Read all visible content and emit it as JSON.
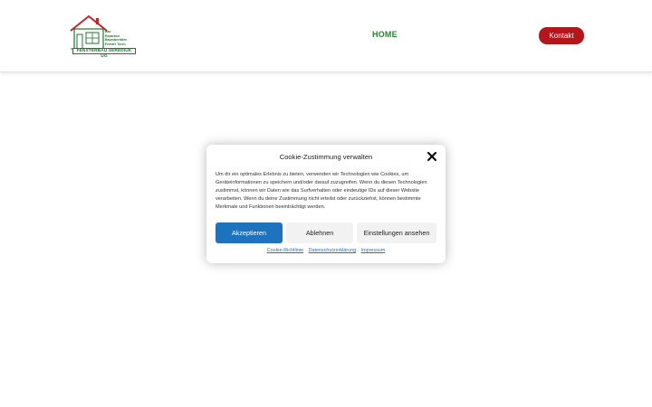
{
  "header": {
    "logo": {
      "tagline_lines": [
        "Bau",
        "Reparatur",
        "Baumaterialien",
        "Fenster Türen"
      ],
      "company_name": "FENSTERBAU SEREDIUK UG"
    },
    "nav": {
      "home_label": "HOME"
    },
    "contact_label": "Kontakt"
  },
  "cookie_dialog": {
    "title": "Cookie-Zustimmung verwalten",
    "close_icon": "close-icon",
    "body": "Um dir ein optimales Erlebnis zu bieten, verwenden wir Technologien wie Cookies, um Geräteinformationen zu speichern und/oder darauf zuzugreifen. Wenn du diesen Technologien zustimmst, können wir Daten wie das Surfverhalten oder eindeutige IDs auf dieser Website verarbeiten. Wenn du deine Zustimmung nicht erteilst oder zurückziehst, können bestimmte Merkmale und Funktionen beeinträchtigt werden.",
    "buttons": {
      "accept": "Akzeptieren",
      "deny": "Ablehnen",
      "settings": "Einstellungen ansehen"
    },
    "links": {
      "cookie_policy": "Cookie-Richtlinie",
      "privacy": "Datenschutzerklärung",
      "imprint": "Impressum"
    }
  },
  "colors": {
    "brand_green": "#1f8a2a",
    "contact_red": "#b4161b",
    "accept_blue": "#1e73be"
  }
}
